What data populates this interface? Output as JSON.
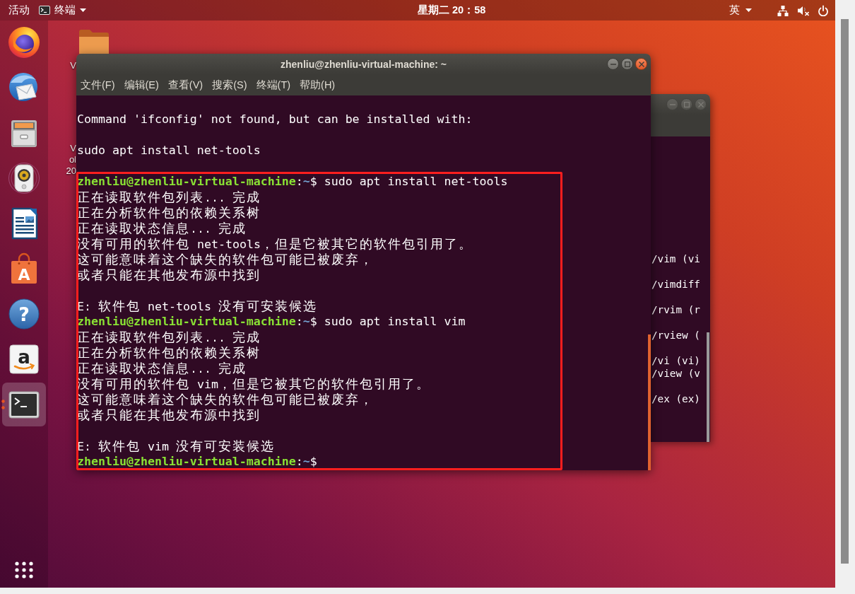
{
  "top_bar": {
    "activities": "活动",
    "app_menu": {
      "label": "终端"
    },
    "clock": "星期二 20：58",
    "input_method": "英",
    "sound_muted": true
  },
  "dock": {
    "items": [
      {
        "kind": "browser",
        "selected": false,
        "running": false
      },
      {
        "kind": "mail",
        "selected": false,
        "running": false
      },
      {
        "kind": "files",
        "selected": false,
        "running": false
      },
      {
        "kind": "music",
        "selected": false,
        "running": false
      },
      {
        "kind": "writer",
        "selected": false,
        "running": false
      },
      {
        "kind": "store",
        "glyph": "A",
        "selected": false,
        "running": false
      },
      {
        "kind": "help",
        "glyph": "?",
        "selected": false,
        "running": false
      },
      {
        "kind": "shop",
        "glyph": "a",
        "selected": false,
        "running": false
      },
      {
        "kind": "terminal",
        "selected": true,
        "running": true
      }
    ]
  },
  "desktop_icons": [
    {
      "kind": "folder",
      "label_lines": [
        "V"
      ]
    },
    {
      "kind": "file",
      "label_lines": [
        "V",
        "ol",
        "20"
      ]
    }
  ],
  "terminal": {
    "title": "zhenliu@zhenliu-virtual-machine: ~",
    "focused": true,
    "menu": [
      "文件(F)",
      "编辑(E)",
      "查看(V)",
      "搜索(S)",
      "终端(T)",
      "帮助(H)"
    ],
    "lines": [
      {
        "kind": "blank"
      },
      {
        "kind": "text",
        "text": "Command 'ifconfig' not found, but can be installed with:"
      },
      {
        "kind": "blank"
      },
      {
        "kind": "text",
        "text": "sudo apt install net-tools"
      },
      {
        "kind": "blank"
      }
    ],
    "boxed_lines": [
      {
        "kind": "prompt",
        "parts": [
          {
            "kind": "user",
            "text": "zhenliu@zhenliu-virtual-machine"
          },
          {
            "kind": "plain",
            "text": ":"
          },
          {
            "kind": "path",
            "text": "~"
          },
          {
            "kind": "plain",
            "text": "$ sudo apt install net-tools"
          }
        ]
      },
      {
        "kind": "text",
        "text": "正在读取软件包列表... 完成"
      },
      {
        "kind": "text",
        "text": "正在分析软件包的依赖关系树"
      },
      {
        "kind": "text",
        "text": "正在读取状态信息... 完成"
      },
      {
        "kind": "text",
        "text": "没有可用的软件包 net-tools，但是它被其它的软件包引用了。"
      },
      {
        "kind": "text",
        "text": "这可能意味着这个缺失的软件包可能已被废弃，"
      },
      {
        "kind": "text",
        "text": "或者只能在其他发布源中找到"
      },
      {
        "kind": "blank"
      },
      {
        "kind": "text",
        "text": "E: 软件包 net-tools 没有可安装候选"
      },
      {
        "kind": "prompt",
        "parts": [
          {
            "kind": "user",
            "text": "zhenliu@zhenliu-virtual-machine"
          },
          {
            "kind": "plain",
            "text": ":"
          },
          {
            "kind": "path",
            "text": "~"
          },
          {
            "kind": "plain",
            "text": "$ sudo apt install vim"
          }
        ]
      },
      {
        "kind": "text",
        "text": "正在读取软件包列表... 完成"
      },
      {
        "kind": "text",
        "text": "正在分析软件包的依赖关系树"
      },
      {
        "kind": "text",
        "text": "正在读取状态信息... 完成"
      },
      {
        "kind": "text",
        "text": "没有可用的软件包 vim，但是它被其它的软件包引用了。"
      },
      {
        "kind": "text",
        "text": "这可能意味着这个缺失的软件包可能已被废弃，"
      },
      {
        "kind": "text",
        "text": "或者只能在其他发布源中找到"
      },
      {
        "kind": "blank"
      },
      {
        "kind": "text",
        "text": "E: 软件包 vim 没有可安装候选"
      },
      {
        "kind": "prompt",
        "parts": [
          {
            "kind": "user",
            "text": "zhenliu@zhenliu-virtual-machine"
          },
          {
            "kind": "plain",
            "text": ":"
          },
          {
            "kind": "path",
            "text": "~"
          },
          {
            "kind": "plain",
            "text": "$"
          }
        ]
      }
    ]
  },
  "background_terminal": {
    "focused": false,
    "lines": [
      {
        "kind": "text",
        "text": "/vim (vi"
      },
      {
        "kind": "blank"
      },
      {
        "kind": "text",
        "text": "/vimdiff"
      },
      {
        "kind": "blank"
      },
      {
        "kind": "text",
        "text": "/rvim (r"
      },
      {
        "kind": "blank"
      },
      {
        "kind": "text",
        "text": "/rview ("
      },
      {
        "kind": "blank"
      },
      {
        "kind": "text",
        "text": "/vi (vi)"
      },
      {
        "kind": "text",
        "text": "/view (v"
      },
      {
        "kind": "blank"
      },
      {
        "kind": "text",
        "text": "/ex (ex)"
      }
    ]
  }
}
